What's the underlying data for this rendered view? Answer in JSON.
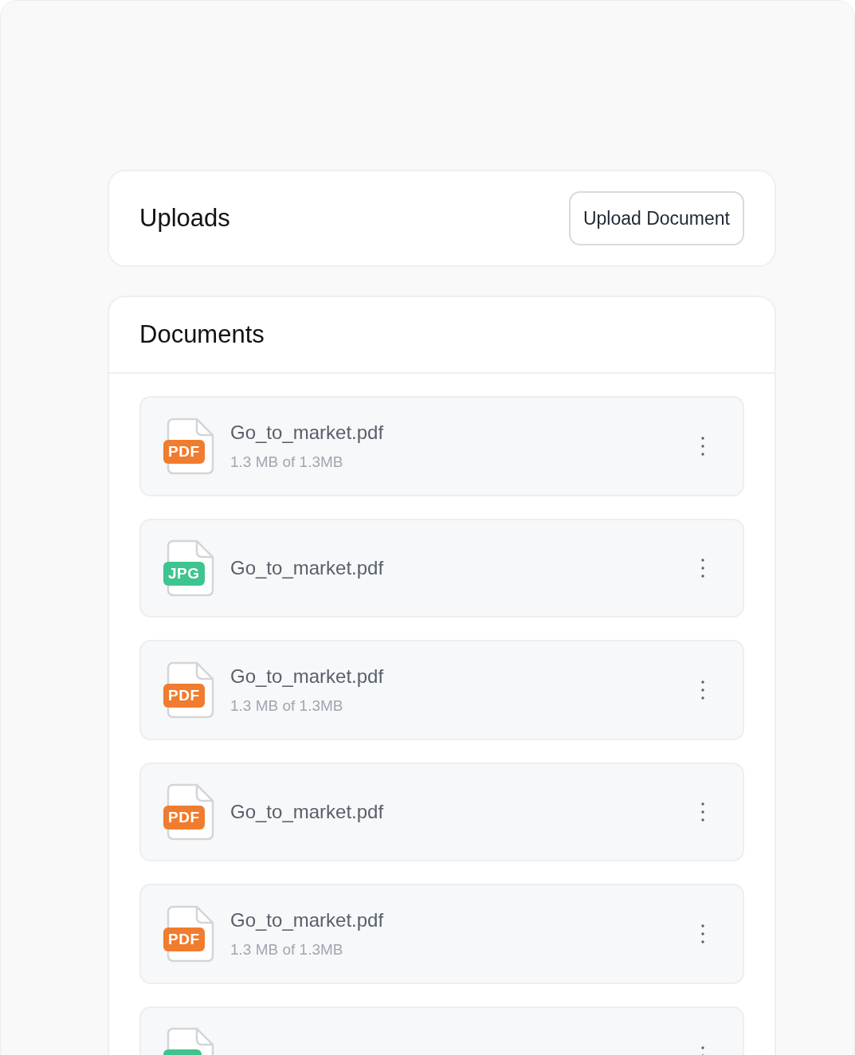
{
  "uploads": {
    "title": "Uploads",
    "button": "Upload Document"
  },
  "documents": {
    "title": "Documents",
    "files": [
      {
        "kind": "pdf",
        "badge": "PDF",
        "name": "Go_to_market.pdf",
        "progress": "1.3 MB of 1.3MB"
      },
      {
        "kind": "jpg",
        "badge": "JPG",
        "name": "Go_to_market.pdf"
      },
      {
        "kind": "pdf",
        "badge": "PDF",
        "name": "Go_to_market.pdf",
        "progress": "1.3 MB of 1.3MB"
      },
      {
        "kind": "pdf",
        "badge": "PDF",
        "name": "Go_to_market.pdf"
      },
      {
        "kind": "pdf",
        "badge": "PDF",
        "name": "Go_to_market.pdf",
        "progress": "1.3 MB of 1.3MB"
      },
      {
        "kind": "jpg"
      }
    ]
  }
}
